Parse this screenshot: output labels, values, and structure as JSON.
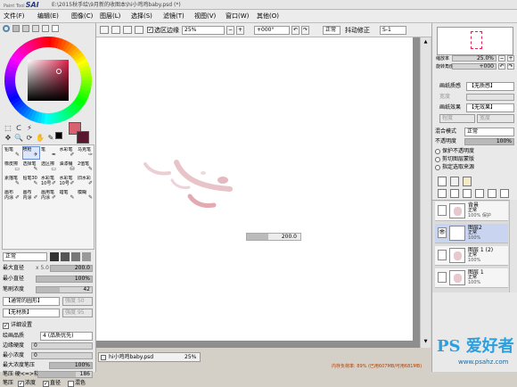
{
  "app": {
    "logo_small": "Paint Tool",
    "logo": "SAI",
    "title": "E:\\2015秋手绘\\9月新的收图本\\hi小鸡鸡baby.psd (*)"
  },
  "menu": [
    "文件(F)",
    "编辑(E)",
    "图像(C)",
    "图层(L)",
    "选择(S)",
    "滤镜(T)",
    "视图(V)",
    "窗口(W)",
    "其他(O)"
  ],
  "toolbar": {
    "selection_edge": "选区边缘",
    "zoom": "25%",
    "angle": "+000°",
    "blend": "正常",
    "stabilizer_label": "抖动修正",
    "stabilizer": "S-1"
  },
  "tools": {
    "brushes": [
      "铅笔",
      "喷枪",
      "笔",
      "水彩笔",
      "马克笔",
      "橡皮擦",
      "选择笔",
      "选区擦",
      "油漆桶",
      "2值笔",
      "素描笔",
      "铅笔30",
      "水彩笔",
      "水彩笔",
      "旧水彩",
      "画布",
      "画布",
      "画用笔",
      "蜡笔",
      "模糊"
    ],
    "brush_sub": [
      "",
      "",
      "",
      "",
      "",
      "",
      "",
      "",
      "",
      "",
      "",
      "",
      "10号",
      "10号",
      "",
      "内涂",
      "内涂",
      "内涂",
      "",
      ""
    ],
    "blend": "正常"
  },
  "brush_settings": {
    "max_size_label": "最大直径",
    "max_size_mult": "x 5.0",
    "max_size": "200.0",
    "min_size_label": "最小直径",
    "min_size": "100%",
    "min_size_pct": 1.0,
    "density_label": "笔刷浓度",
    "density": "42",
    "density_pct": 0.42,
    "shape": "【通常的圆形】",
    "shape_strength_label": "强度",
    "shape_strength": "50",
    "texture": "【无材质】",
    "texture_strength_label": "强度",
    "texture_strength": "95",
    "detail_label": "详细设置",
    "quality_label": "绘画品质",
    "quality": "4 (品质优先)",
    "edge_hardness_label": "边缘硬度",
    "edge_hardness": "0",
    "min_density_label": "最小浓度",
    "min_density": "0",
    "max_pressure_label": "最大浓度笔压",
    "max_pressure": "100%",
    "max_pressure_pct": 1.0,
    "pressure_label": "笔压 硬<=>软",
    "pressure": "186",
    "pressure_opts": [
      "笔压",
      "浓度",
      "直径",
      "混色"
    ]
  },
  "canvas": {
    "brush_size_popup": "200.0",
    "brush_size_fraction": 0.4
  },
  "tab": {
    "name": "hi小鸡鸡baby.psd",
    "zoom": "25%"
  },
  "status": {
    "memory": "内存负荷率: 89% (已用607MB/可用681MB)"
  },
  "watermark": {
    "big": "PS 爱好者",
    "url": "www.psahz.com"
  },
  "navigator": {
    "zoom_label": "缩放率",
    "zoom": "25.0%",
    "angle_label": "旋转角度",
    "angle": "+000"
  },
  "layer_panel": {
    "paper_texture_label": "画纸质感",
    "paper_texture": "【无质感】",
    "effect_label": "画纸效果",
    "effect": "【无效果】",
    "strength_label": "程度",
    "width_label": "宽度",
    "blend_label": "混合模式",
    "blend": "正常",
    "opacity_label": "不透明度",
    "opacity": "100%",
    "opacity_pct": 1.0,
    "protect_label": "保护不透明度",
    "clip_label": "剪切图层蒙版",
    "select_label": "指定选取来源"
  },
  "layers": [
    {
      "name": "背景",
      "mode": "正常",
      "opacity": "100%",
      "extra": "保护",
      "selected": false,
      "has_art": true
    },
    {
      "name": "图层2",
      "mode": "正常",
      "opacity": "100%",
      "extra": "",
      "selected": true,
      "has_art": false
    },
    {
      "name": "图层 1 (2)",
      "mode": "正常",
      "opacity": "100%",
      "extra": "",
      "selected": false,
      "has_art": true
    },
    {
      "name": "图层 1",
      "mode": "正常",
      "opacity": "100%",
      "extra": "",
      "selected": false,
      "has_art": true
    }
  ],
  "colors": {
    "primary": "#d9606e",
    "secondary": "#5a1830",
    "accent": "#6b8fd6"
  }
}
